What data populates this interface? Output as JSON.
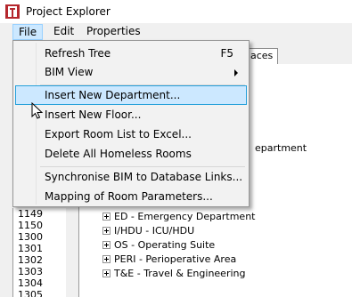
{
  "window": {
    "title": "Project Explorer"
  },
  "menubar": {
    "file": "File",
    "edit": "Edit",
    "properties": "Properties"
  },
  "tabs": {
    "visible_tab": "aces"
  },
  "file_menu": {
    "items": [
      {
        "label": "Refresh Tree",
        "shortcut": "F5"
      },
      {
        "label": "BIM View",
        "submenu": true
      },
      {
        "label": "Insert New Department...",
        "highlighted": true
      },
      {
        "label": "Insert New Floor..."
      },
      {
        "label": "Export Room List to Excel..."
      },
      {
        "label": "Delete All Homeless Rooms"
      },
      {
        "label": "Synchronise BIM to Database Links..."
      },
      {
        "label": "Mapping of Room Parameters..."
      }
    ]
  },
  "left_list": {
    "rows": [
      "1149",
      "1150",
      "1300",
      "1301",
      "1302",
      "1303",
      "1304",
      "1305"
    ]
  },
  "tree": {
    "partial_text": "epartment",
    "items": [
      "ED - Emergency Department",
      "I/HDU - ICU/HDU",
      "OS - Operating Suite",
      "PERI - Perioperative Area",
      "T&E - Travel & Engineering"
    ]
  },
  "colors": {
    "highlight_fill": "#cce8ff",
    "highlight_border": "#26a0da",
    "app_icon_red": "#b5272d"
  }
}
